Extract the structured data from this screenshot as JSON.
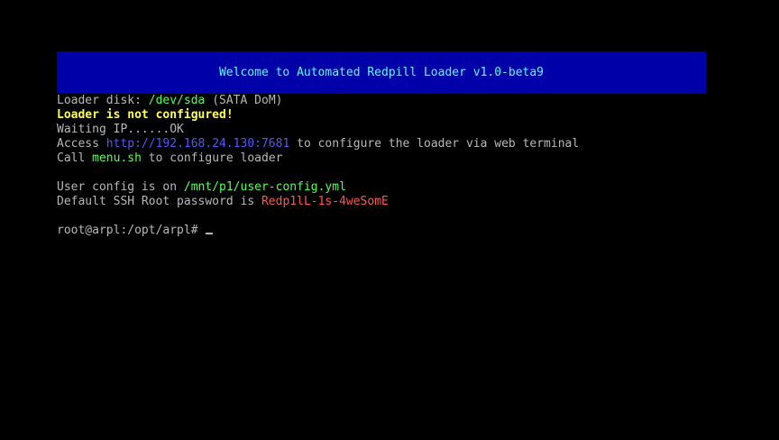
{
  "banner": {
    "title": "Welcome to Automated Redpill Loader v1.0-beta9"
  },
  "lines": {
    "disk_label": "Loader disk: ",
    "disk_path": "/dev/sda",
    "disk_type": " (SATA DoM)",
    "not_configured": "Loader is not configured!",
    "waiting_ip": "Waiting IP......OK",
    "access_prefix": "Access ",
    "access_url": "http://192.168.24.130:7681",
    "access_suffix": " to configure the loader via web terminal",
    "call_prefix": "Call ",
    "call_cmd": "menu.sh",
    "call_suffix": " to configure loader",
    "user_config_prefix": "User config is on ",
    "user_config_path": "/mnt/p1/user-config.yml",
    "ssh_prefix": "Default SSH Root password is ",
    "ssh_password": "Redp1lL-1s-4weSomE",
    "prompt": "root@arpl:/opt/arpl# "
  },
  "colors": {
    "background": "#000000",
    "banner_bg": "#0000a8",
    "banner_text": "#55ffff",
    "default_text": "#b8b8b8",
    "path_green": "#55ff55",
    "warning_yellow": "#ffff55",
    "url_blue": "#5555ff",
    "password_red": "#ff5555"
  }
}
